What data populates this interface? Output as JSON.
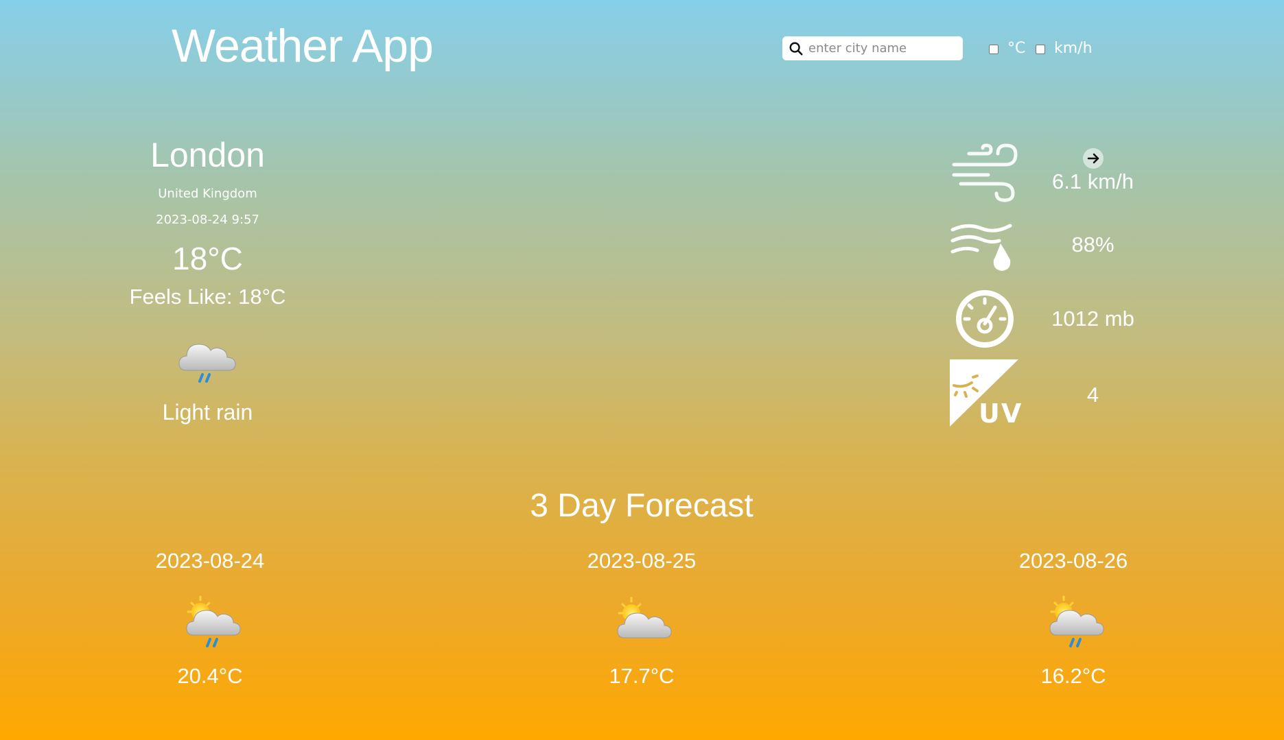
{
  "header": {
    "title": "Weather App",
    "search_placeholder": "enter city name",
    "search_value": "",
    "unit_temp_label": "°C",
    "unit_speed_label": "km/h"
  },
  "current": {
    "city": "London",
    "country": "United Kingdom",
    "datetime": "2023-08-24 9:57",
    "temperature": "18°C",
    "feels_like": "Feels Like:  18°C",
    "condition": "Light rain",
    "icon": "light-rain-cloud-icon"
  },
  "stats": {
    "wind_speed": "6.1 km/h",
    "wind_direction_icon": "arrow-right-icon",
    "humidity": "88%",
    "pressure": "1012 mb",
    "uv_index": "4"
  },
  "forecast": {
    "title": "3 Day Forecast",
    "days": [
      {
        "date": "2023-08-24",
        "temp": "20.4°C",
        "icon": "sun-cloud-rain-icon"
      },
      {
        "date": "2023-08-25",
        "temp": "17.7°C",
        "icon": "sun-cloud-icon"
      },
      {
        "date": "2023-08-26",
        "temp": "16.2°C",
        "icon": "sun-cloud-rain-icon"
      }
    ]
  },
  "colors": {
    "gradient_top": "#86cfea",
    "gradient_bottom": "#ffa800",
    "text": "#ffffff",
    "rain": "#2a8fd8",
    "sun": "#ffd23a"
  }
}
